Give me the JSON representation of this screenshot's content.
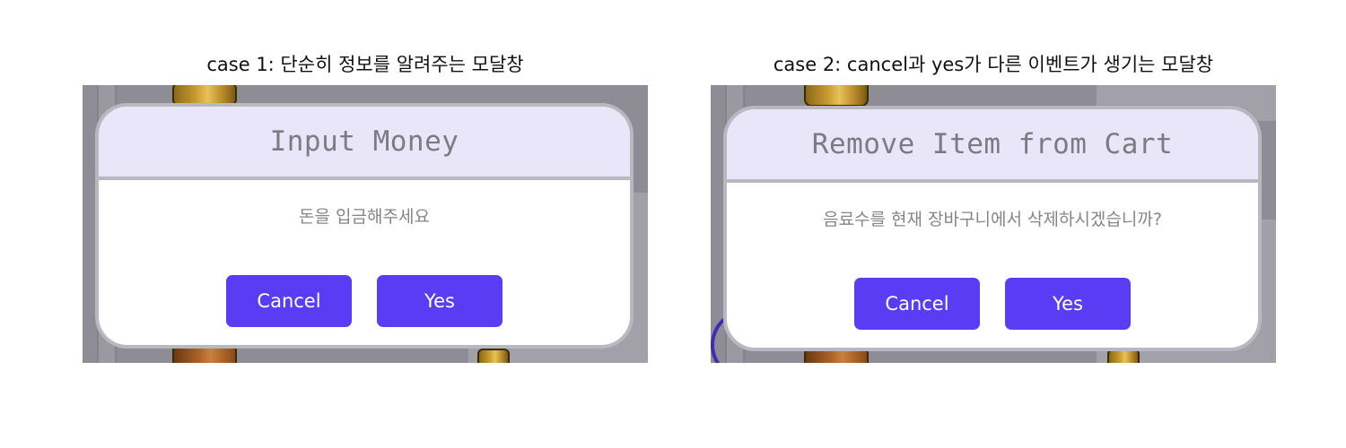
{
  "colors": {
    "button": "#5b3cf5",
    "button_text": "#ffffff",
    "modal_header_bg": "#e8e6f8",
    "modal_border": "#b9b8c0",
    "title_text": "#7c7b83",
    "message_text": "#85848c",
    "overlay": "#8e8d96"
  },
  "case1": {
    "caption": "case 1: 단순히 정보를 알려주는 모달창",
    "modal": {
      "title": "Input Money",
      "message": "돈을 입금해주세요",
      "cancel_label": "Cancel",
      "yes_label": "Yes"
    }
  },
  "case2": {
    "caption": "case 2: cancel과 yes가 다른 이벤트가 생기는 모달창",
    "modal": {
      "title": "Remove Item from Cart",
      "message": "음료수를 현재 장바구니에서 삭제하시겠습니까?",
      "cancel_label": "Cancel",
      "yes_label": "Yes"
    }
  }
}
